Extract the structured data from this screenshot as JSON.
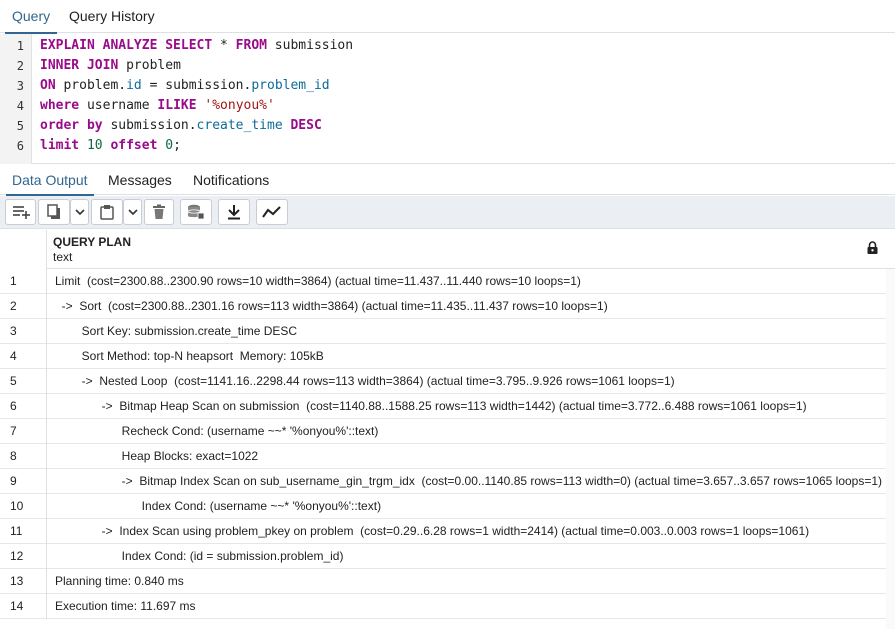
{
  "top_tabs": [
    "Query",
    "Query History"
  ],
  "editor": {
    "line_numbers": [
      "1",
      "2",
      "3",
      "4",
      "5",
      "6"
    ],
    "lines": [
      [
        {
          "t": "EXPLAIN ANALYZE SELECT",
          "c": "kw"
        },
        {
          "t": " * ",
          "c": "ident"
        },
        {
          "t": "FROM",
          "c": "kw"
        },
        {
          "t": " submission",
          "c": "ident"
        }
      ],
      [
        {
          "t": "INNER JOIN",
          "c": "kw"
        },
        {
          "t": " problem",
          "c": "ident"
        }
      ],
      [
        {
          "t": "ON",
          "c": "kw"
        },
        {
          "t": " problem.",
          "c": "ident"
        },
        {
          "t": "id",
          "c": "prop"
        },
        {
          "t": " = submission.",
          "c": "ident"
        },
        {
          "t": "problem_id",
          "c": "prop"
        }
      ],
      [
        {
          "t": "where",
          "c": "kw"
        },
        {
          "t": " username ",
          "c": "ident"
        },
        {
          "t": "ILIKE",
          "c": "kw"
        },
        {
          "t": " ",
          "c": "ident"
        },
        {
          "t": "'%onyou%'",
          "c": "str"
        }
      ],
      [
        {
          "t": "order by",
          "c": "kw"
        },
        {
          "t": " submission.",
          "c": "ident"
        },
        {
          "t": "create_time",
          "c": "prop"
        },
        {
          "t": " ",
          "c": "ident"
        },
        {
          "t": "DESC",
          "c": "kw"
        }
      ],
      [
        {
          "t": "limit",
          "c": "kw"
        },
        {
          "t": " ",
          "c": "ident"
        },
        {
          "t": "10",
          "c": "num"
        },
        {
          "t": " ",
          "c": "ident"
        },
        {
          "t": "offset",
          "c": "kw"
        },
        {
          "t": " ",
          "c": "ident"
        },
        {
          "t": "0",
          "c": "num"
        },
        {
          "t": ";",
          "c": "ident"
        }
      ]
    ]
  },
  "bottom_tabs": [
    "Data Output",
    "Messages",
    "Notifications"
  ],
  "toolbar": {
    "buttons": [
      "add-row-icon",
      "copy-icon",
      "chevron-down-icon",
      "paste-icon",
      "chevron-down-icon",
      "delete-icon",
      "save-data-icon",
      "download-icon",
      "graph-icon"
    ]
  },
  "grid": {
    "column": {
      "name": "QUERY PLAN",
      "type": "text"
    },
    "rows": [
      {
        "n": "1",
        "text": "Limit  (cost=2300.88..2300.90 rows=10 width=3864) (actual time=11.437..11.440 rows=10 loops=1)"
      },
      {
        "n": "2",
        "text": "  ->  Sort  (cost=2300.88..2301.16 rows=113 width=3864) (actual time=11.435..11.437 rows=10 loops=1)"
      },
      {
        "n": "3",
        "text": "        Sort Key: submission.create_time DESC"
      },
      {
        "n": "4",
        "text": "        Sort Method: top-N heapsort  Memory: 105kB"
      },
      {
        "n": "5",
        "text": "        ->  Nested Loop  (cost=1141.16..2298.44 rows=113 width=3864) (actual time=3.795..9.926 rows=1061 loops=1)"
      },
      {
        "n": "6",
        "text": "              ->  Bitmap Heap Scan on submission  (cost=1140.88..1588.25 rows=113 width=1442) (actual time=3.772..6.488 rows=1061 loops=1)"
      },
      {
        "n": "7",
        "text": "                    Recheck Cond: (username ~~* '%onyou%'::text)"
      },
      {
        "n": "8",
        "text": "                    Heap Blocks: exact=1022"
      },
      {
        "n": "9",
        "text": "                    ->  Bitmap Index Scan on sub_username_gin_trgm_idx  (cost=0.00..1140.85 rows=113 width=0) (actual time=3.657..3.657 rows=1065 loops=1)"
      },
      {
        "n": "10",
        "text": "                          Index Cond: (username ~~* '%onyou%'::text)"
      },
      {
        "n": "11",
        "text": "              ->  Index Scan using problem_pkey on problem  (cost=0.29..6.28 rows=1 width=2414) (actual time=0.003..0.003 rows=1 loops=1061)"
      },
      {
        "n": "12",
        "text": "                    Index Cond: (id = submission.problem_id)"
      },
      {
        "n": "13",
        "text": "Planning time: 0.840 ms"
      },
      {
        "n": "14",
        "text": "Execution time: 11.697 ms"
      }
    ]
  }
}
